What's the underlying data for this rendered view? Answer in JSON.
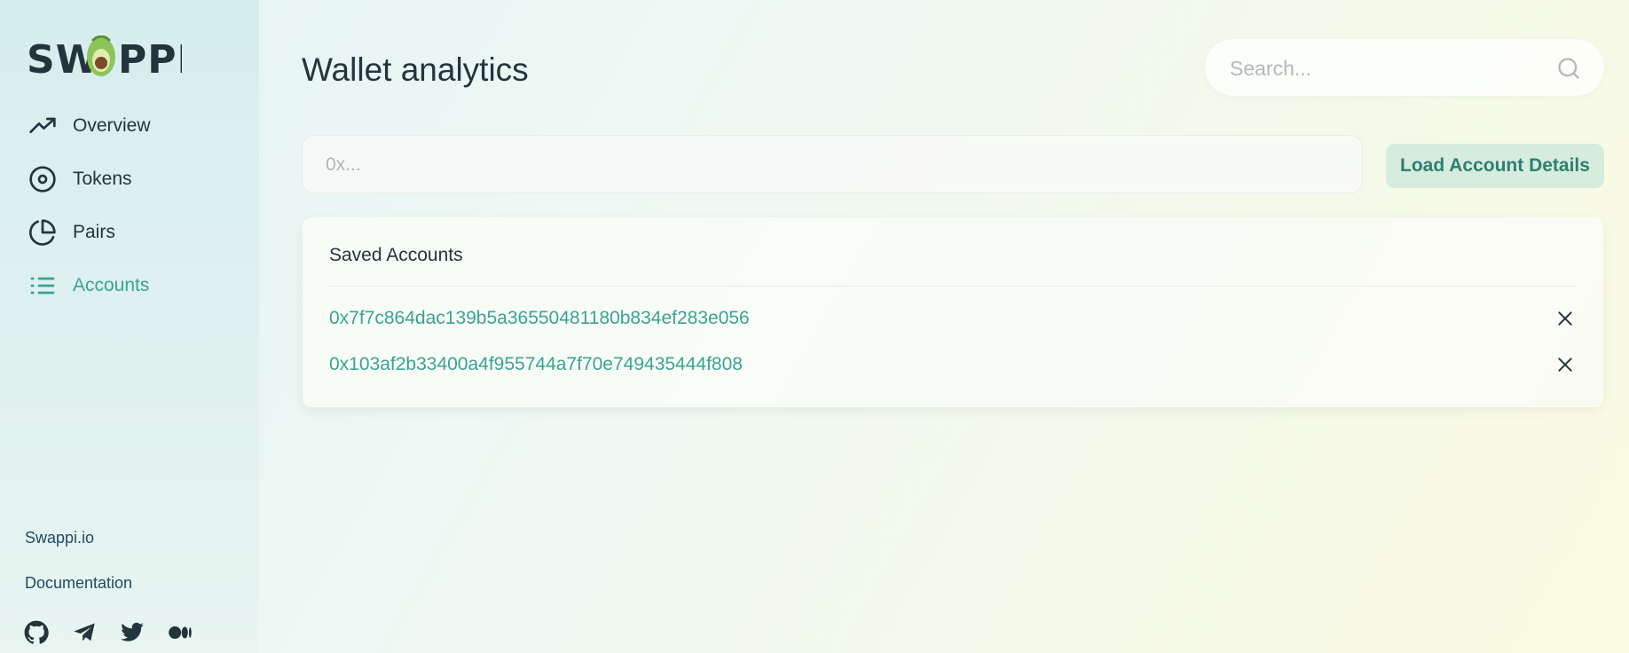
{
  "brand": {
    "logo_text": "SWAPPI"
  },
  "sidebar": {
    "nav": [
      {
        "label": "Overview",
        "icon": "trending-up-icon"
      },
      {
        "label": "Tokens",
        "icon": "target-icon"
      },
      {
        "label": "Pairs",
        "icon": "pie-chart-icon"
      },
      {
        "label": "Accounts",
        "icon": "list-icon",
        "active": true
      }
    ],
    "links": [
      {
        "label": "Swappi.io"
      },
      {
        "label": "Documentation"
      }
    ],
    "social": [
      "github-icon",
      "telegram-icon",
      "twitter-icon",
      "medium-icon"
    ]
  },
  "header": {
    "title": "Wallet analytics",
    "search_placeholder": "Search..."
  },
  "account_form": {
    "input_placeholder": "0x...",
    "button_label": "Load Account Details"
  },
  "saved_accounts": {
    "title": "Saved Accounts",
    "items": [
      {
        "address": "0x7f7c864dac139b5a36550481180b834ef283e056"
      },
      {
        "address": "0x103af2b33400a4f955744a7f70e749435444f808"
      }
    ]
  },
  "colors": {
    "accent": "#3aa394",
    "text": "#25343d",
    "button_bg": "#d6ecdc",
    "button_text": "#2f7e72",
    "link_dark": "#1f4a66"
  }
}
